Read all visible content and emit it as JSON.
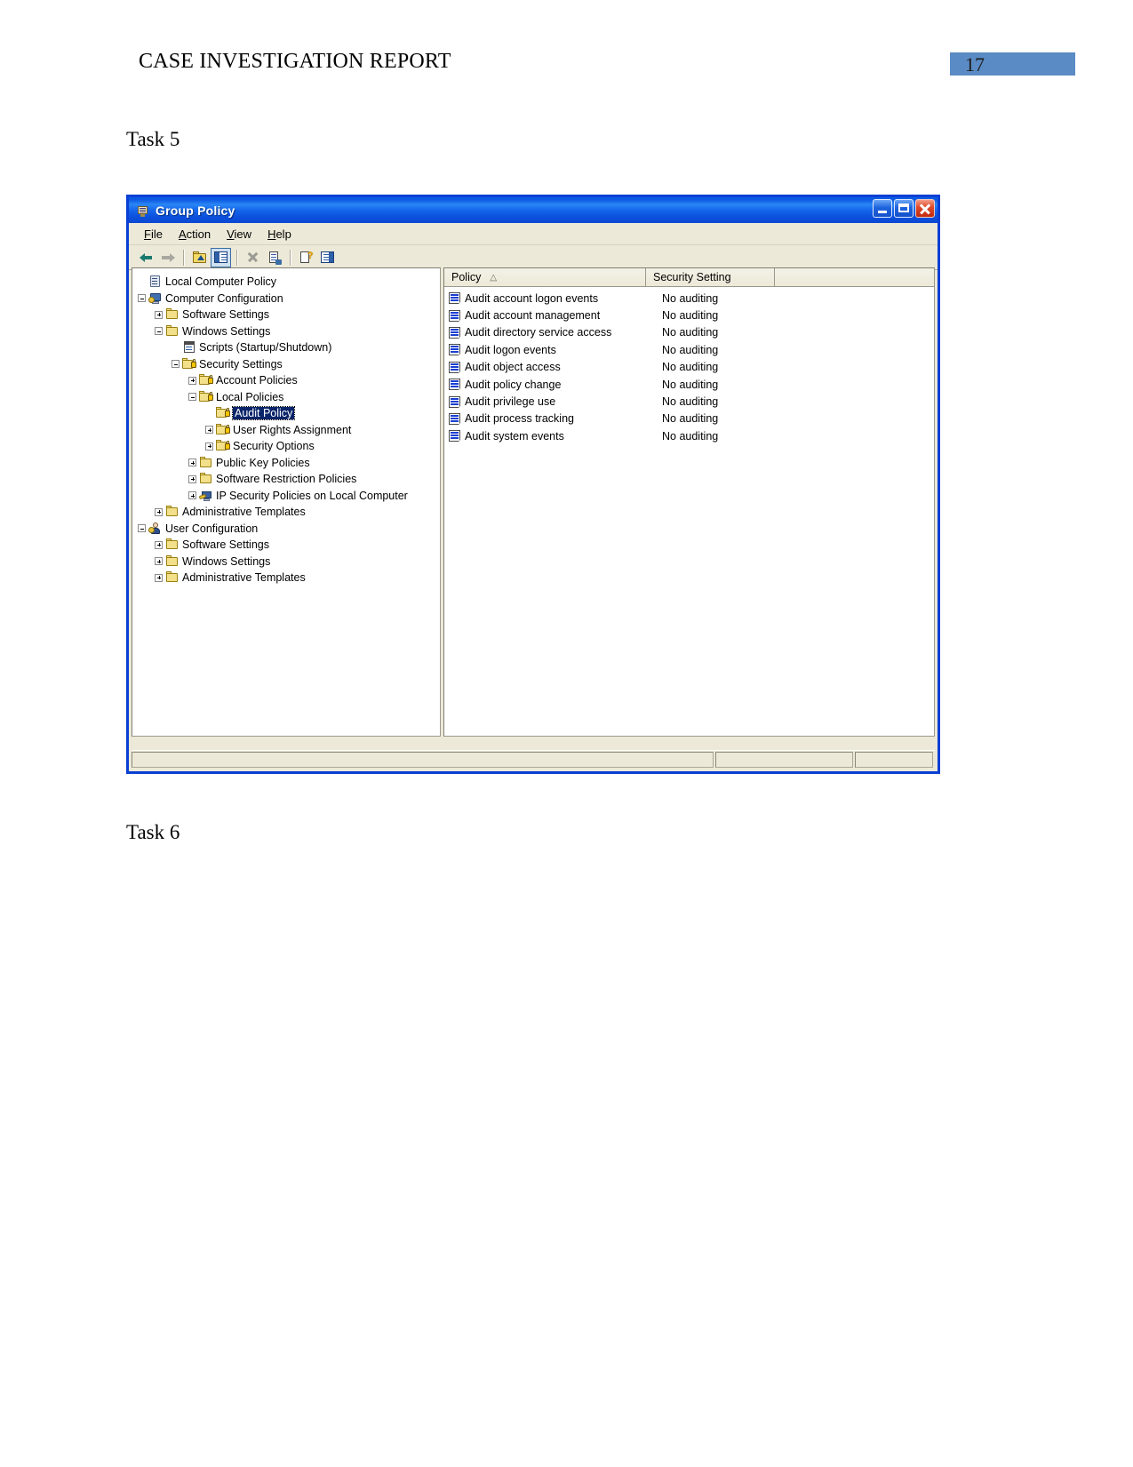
{
  "document": {
    "header_title": "CASE INVESTIGATION REPORT",
    "page_number": "17",
    "page_number_color": "#5b8bc4",
    "task5_label": "Task 5",
    "task6_label": "Task 6"
  },
  "window": {
    "title": "Group Policy",
    "title_icon": "group-policy-icon",
    "controls": {
      "minimize": "Minimize",
      "maximize": "Maximize",
      "close": "Close"
    },
    "menu": [
      {
        "label": "File",
        "accel": "F"
      },
      {
        "label": "Action",
        "accel": "A"
      },
      {
        "label": "View",
        "accel": "V"
      },
      {
        "label": "Help",
        "accel": "H"
      }
    ],
    "toolbar": [
      {
        "name": "back-arrow-icon",
        "tooltip": "Back"
      },
      {
        "name": "forward-arrow-icon",
        "tooltip": "Forward"
      },
      {
        "name": "up-one-level-icon",
        "tooltip": "Up One Level"
      },
      {
        "name": "show-hide-tree-icon",
        "tooltip": "Show/Hide Console Tree",
        "pressed": true
      },
      {
        "name": "delete-icon",
        "tooltip": "Delete"
      },
      {
        "name": "properties-icon",
        "tooltip": "Properties"
      },
      {
        "name": "help-icon",
        "tooltip": "Help"
      },
      {
        "name": "export-list-icon",
        "tooltip": "Export List"
      }
    ]
  },
  "tree": [
    {
      "label": "Local Computer Policy",
      "depth": 0,
      "toggle": "none",
      "icon": "policy-scroll-icon"
    },
    {
      "label": "Computer Configuration",
      "depth": 0,
      "toggle": "minus",
      "icon": "computer-config-icon"
    },
    {
      "label": "Software Settings",
      "depth": 1,
      "toggle": "plus",
      "icon": "folder-icon"
    },
    {
      "label": "Windows Settings",
      "depth": 1,
      "toggle": "minus",
      "icon": "folder-icon"
    },
    {
      "label": "Scripts (Startup/Shutdown)",
      "depth": 2,
      "toggle": "none",
      "icon": "script-icon"
    },
    {
      "label": "Security Settings",
      "depth": 2,
      "toggle": "minus",
      "icon": "security-settings-icon"
    },
    {
      "label": "Account Policies",
      "depth": 3,
      "toggle": "plus",
      "icon": "lock-folder-icon"
    },
    {
      "label": "Local Policies",
      "depth": 3,
      "toggle": "minus",
      "icon": "lock-folder-icon"
    },
    {
      "label": "Audit Policy",
      "depth": 4,
      "toggle": "none",
      "icon": "lock-folder-icon",
      "selected": true
    },
    {
      "label": "User Rights Assignment",
      "depth": 4,
      "toggle": "plus",
      "icon": "lock-folder-icon"
    },
    {
      "label": "Security Options",
      "depth": 4,
      "toggle": "plus",
      "icon": "lock-folder-icon"
    },
    {
      "label": "Public Key Policies",
      "depth": 3,
      "toggle": "plus",
      "icon": "folder-icon"
    },
    {
      "label": "Software Restriction Policies",
      "depth": 3,
      "toggle": "plus",
      "icon": "folder-icon"
    },
    {
      "label": "IP Security Policies on Local Computer",
      "depth": 3,
      "toggle": "plus",
      "icon": "ip-security-icon"
    },
    {
      "label": "Administrative Templates",
      "depth": 1,
      "toggle": "plus",
      "icon": "folder-icon"
    },
    {
      "label": "User Configuration",
      "depth": 0,
      "toggle": "minus",
      "icon": "user-config-icon"
    },
    {
      "label": "Software Settings",
      "depth": 1,
      "toggle": "plus",
      "icon": "folder-icon"
    },
    {
      "label": "Windows Settings",
      "depth": 1,
      "toggle": "plus",
      "icon": "folder-icon"
    },
    {
      "label": "Administrative Templates",
      "depth": 1,
      "toggle": "plus",
      "icon": "folder-icon"
    }
  ],
  "list": {
    "columns": [
      {
        "label": "Policy",
        "sort_indicator": "△"
      },
      {
        "label": "Security Setting",
        "sort_indicator": ""
      },
      {
        "label": "",
        "sort_indicator": ""
      }
    ],
    "rows": [
      {
        "policy": "Audit account logon events",
        "setting": "No auditing"
      },
      {
        "policy": "Audit account management",
        "setting": "No auditing"
      },
      {
        "policy": "Audit directory service access",
        "setting": "No auditing"
      },
      {
        "policy": "Audit logon events",
        "setting": "No auditing"
      },
      {
        "policy": "Audit object access",
        "setting": "No auditing"
      },
      {
        "policy": "Audit policy change",
        "setting": "No auditing"
      },
      {
        "policy": "Audit privilege use",
        "setting": "No auditing"
      },
      {
        "policy": "Audit process tracking",
        "setting": "No auditing"
      },
      {
        "policy": "Audit system events",
        "setting": "No auditing"
      }
    ]
  },
  "status_bar": {
    "pane1": "",
    "pane2": "",
    "pane3": ""
  }
}
